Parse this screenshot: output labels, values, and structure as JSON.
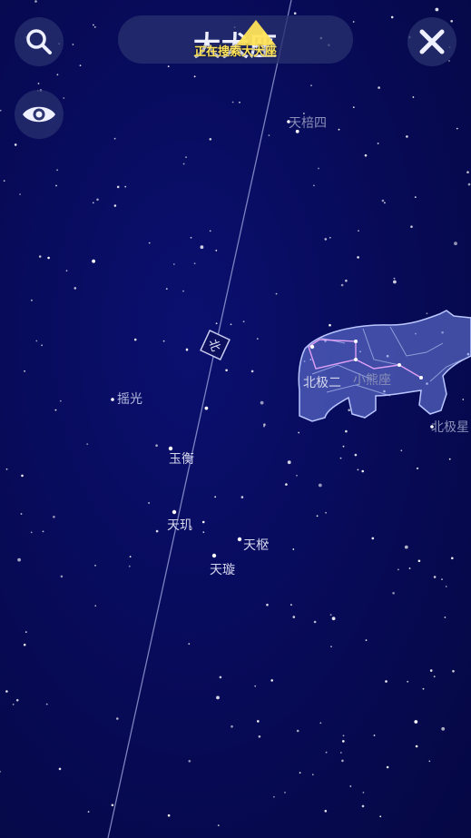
{
  "header": {
    "title": "大犬座",
    "searching_text": "正在搜索大犬座"
  },
  "toolbar": {
    "search_icon": "search-icon",
    "view_icon": "eye-icon",
    "close_icon": "close-icon"
  },
  "horizon_marker": {
    "label": "北"
  },
  "stars": [
    {
      "id": "tianbei4",
      "name": "天棓四"
    },
    {
      "id": "yaoguang",
      "name": "摇光"
    },
    {
      "id": "yuheng",
      "name": "玉衡"
    },
    {
      "id": "tianji",
      "name": "天玑"
    },
    {
      "id": "tianshu",
      "name": "天枢"
    },
    {
      "id": "tianxuan",
      "name": "天璇"
    },
    {
      "id": "beiji2",
      "name": "北极二"
    },
    {
      "id": "ursa-minor",
      "name": "小熊座"
    },
    {
      "id": "polaris",
      "name": "北极星"
    }
  ],
  "colors": {
    "sky": "#070a52",
    "accent": "#ffe35a",
    "constellation": "#8fa0ff"
  }
}
